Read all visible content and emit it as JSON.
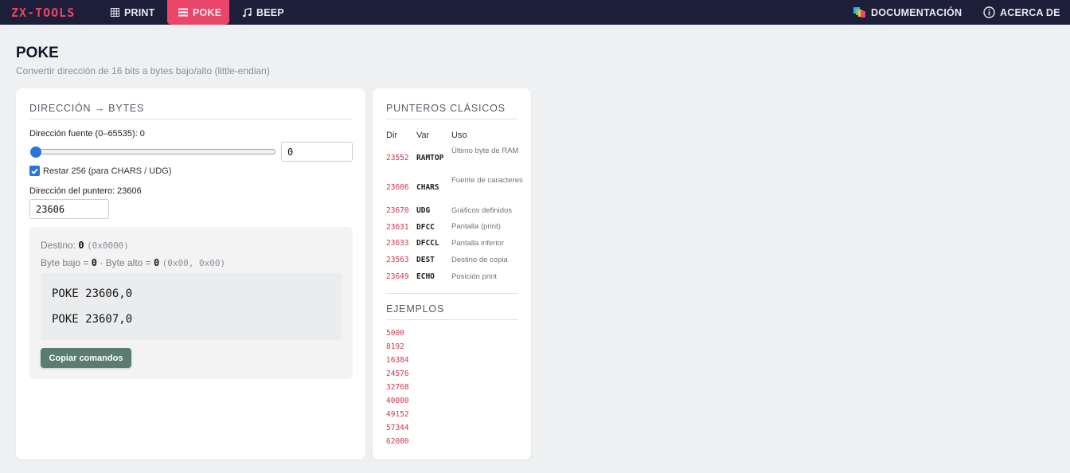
{
  "nav": {
    "brand": "ZX-TOOLS",
    "items": [
      {
        "label": "PRINT",
        "icon": "grid-icon"
      },
      {
        "label": "POKE",
        "icon": "menu-icon"
      },
      {
        "label": "BEEP",
        "icon": "music-note-icon"
      }
    ],
    "docs_label": "DOCUMENTACIÓN",
    "about_label": "ACERCA DE",
    "active_color": "#e9466a",
    "bar_color": "#1d1f3a"
  },
  "page": {
    "title": "POKE",
    "subtitle": "Convertir dirección de 16 bits a bytes bajo/alto (little-endian)"
  },
  "converter": {
    "title": "DIRECCIÓN → BYTES",
    "source_label": "Dirección fuente (0–65535): 0",
    "slider_value": 0,
    "source_value": "0",
    "subtract_checked": true,
    "subtract_label": "Restar 256 (para CHARS / UDG)",
    "pointer_label": "Dirección del puntero: 23606",
    "pointer_value": "23606",
    "result": {
      "dest_label": "Destino:",
      "dest_value": "0",
      "dest_hex": "(0x0000)",
      "low_label": "Byte bajo =",
      "low_value": "0",
      "high_label": "· Byte alto =",
      "high_value": "0",
      "bytes_hex": "(0x00, 0x00)",
      "commands": [
        "POKE 23606,0",
        "POKE 23607,0"
      ],
      "copy_label": "Copiar comandos"
    }
  },
  "pointers": {
    "title": "PUNTEROS CLÁSICOS",
    "headers": [
      "Dir",
      "Var",
      "Uso"
    ],
    "rows": [
      {
        "addr": "23552",
        "var": "RAMTOP",
        "use": "Último byte de RAM"
      },
      {
        "addr": "23606",
        "var": "CHARS",
        "use": "Fuente de caracteres"
      },
      {
        "addr": "23670",
        "var": "UDG",
        "use": "Gráficos definidos"
      },
      {
        "addr": "23631",
        "var": "DFCC",
        "use": "Pantalla (print)"
      },
      {
        "addr": "23633",
        "var": "DFCCL",
        "use": "Pantalla inferior"
      },
      {
        "addr": "23563",
        "var": "DEST",
        "use": "Destino de copia"
      },
      {
        "addr": "23649",
        "var": "ECHO",
        "use": "Posición print"
      }
    ],
    "examples_title": "EJEMPLOS",
    "examples": [
      "5000",
      "8192",
      "16384",
      "24576",
      "32768",
      "40000",
      "49152",
      "57344",
      "62000"
    ]
  }
}
